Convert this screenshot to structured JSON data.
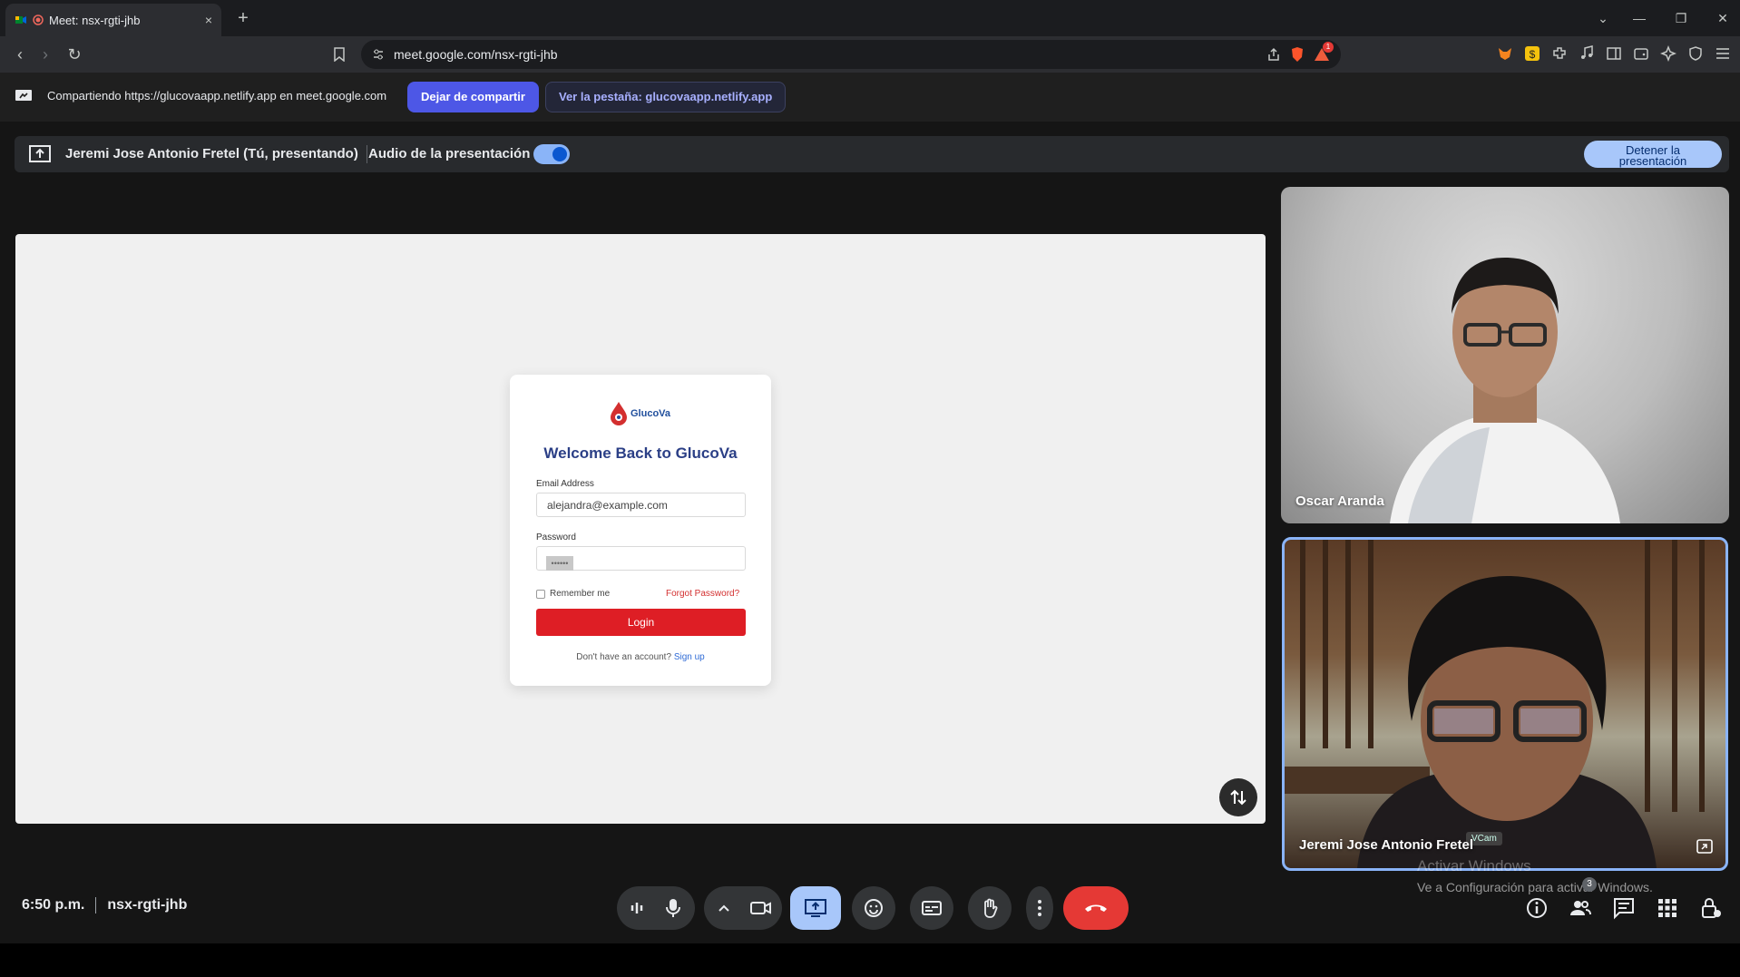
{
  "browser": {
    "tab_title": "Meet: nsx-rgti-jhb",
    "url": "meet.google.com/nsx-rgti-jhb",
    "new_tab": "+",
    "close": "×",
    "notification_count": "1"
  },
  "sharebar": {
    "text": "Compartiendo https://glucovaapp.netlify.app en meet.google.com",
    "stop_sharing": "Dejar de compartir",
    "view_tab": "Ver la pestaña: glucovaapp.netlify.app"
  },
  "presentation": {
    "presenter": "Jeremi Jose Antonio Fretel (Tú, presentando)",
    "audio_label": "Audio de la presentación",
    "stop_line1": "Detener la",
    "stop_line2": "presentación"
  },
  "login_card": {
    "logo_text": "GlucoVa",
    "title": "Welcome Back to GlucoVa",
    "email_label": "Email Address",
    "email_value": "alejandra@example.com",
    "password_label": "Password",
    "password_mask": "••••••",
    "remember": "Remember me",
    "forgot": "Forgot Password?",
    "login": "Login",
    "no_account": "Don't have an account?",
    "signup": "Sign up"
  },
  "participants": [
    {
      "name": "Oscar Aranda"
    },
    {
      "name": "Jeremi Jose Antonio Fretel"
    }
  ],
  "watermark": {
    "line1": "Activar Windows",
    "line2": "Ve a Configuración para activar Windows."
  },
  "bottom": {
    "time": "6:50 p.m.",
    "meeting_code": "nsx-rgti-jhb",
    "people_count": "3"
  },
  "colors": {
    "accent_blue": "#a8c7fa",
    "end_call": "#e53935",
    "share_button": "#4d57e6",
    "login_red": "#de1e25"
  }
}
